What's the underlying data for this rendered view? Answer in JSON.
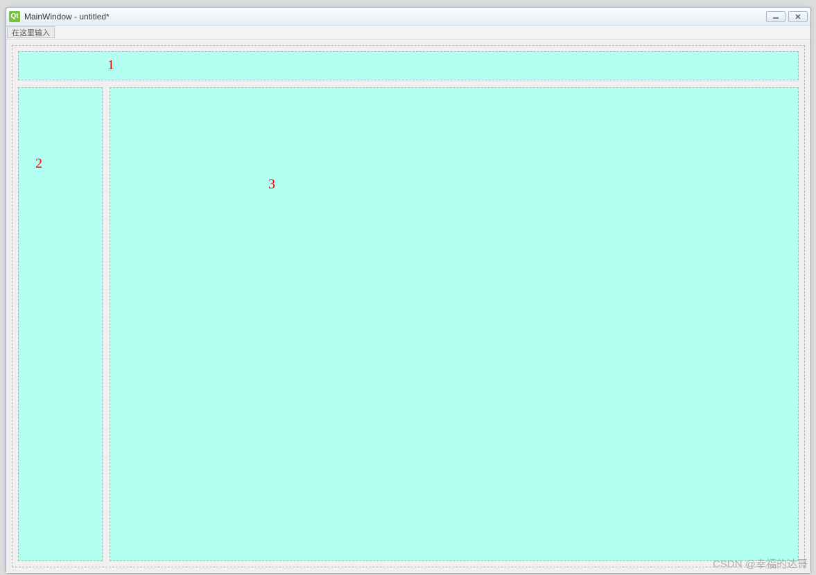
{
  "window": {
    "icon_text": "Qt",
    "title": "MainWindow - untitled*"
  },
  "menubar": {
    "input_placeholder": "在这里输入"
  },
  "panels": {
    "top_label": "1",
    "left_label": "2",
    "right_label": "3"
  },
  "colors": {
    "panel_bg": "#b3fff2",
    "annotation": "#ff0000"
  },
  "watermark": "CSDN @幸福的达哥"
}
